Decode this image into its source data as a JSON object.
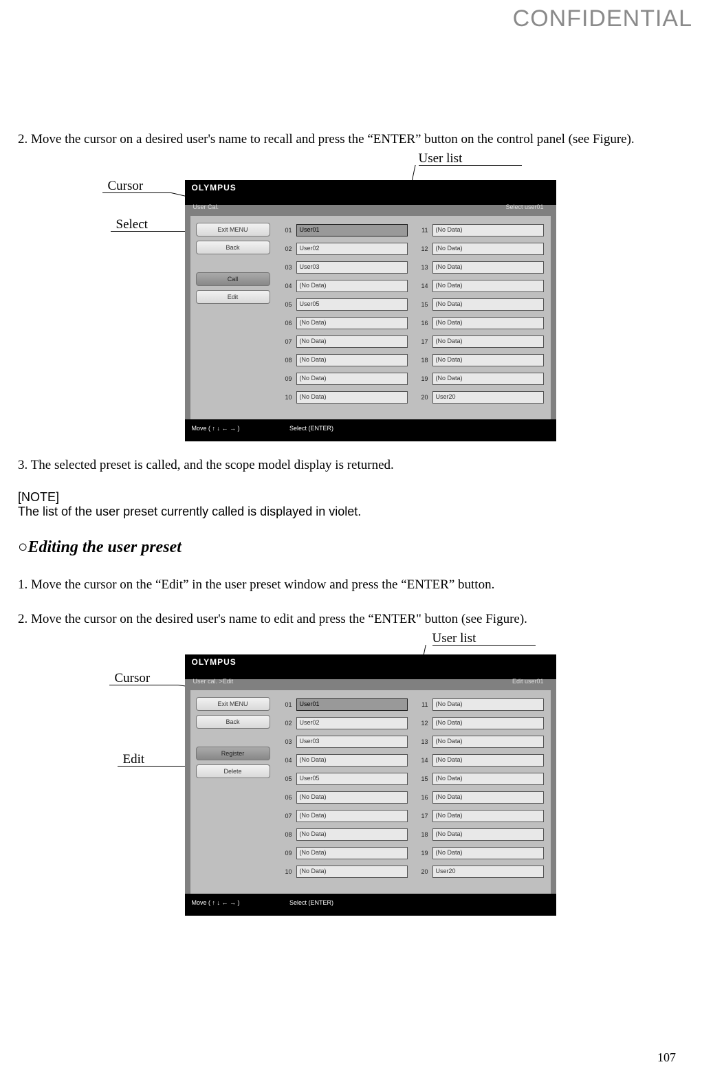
{
  "watermark": "CONFIDENTIAL",
  "page_number": "107",
  "step2": "2. Move the cursor on a desired user's name to recall and press the “ENTER” button on the control panel (see Figure).",
  "step3": "3. The selected preset is called, and the scope model display is returned.",
  "note_label": "[NOTE]",
  "note_body": "The list of the user preset currently called is displayed in violet.",
  "section_heading": "○Editing the user preset",
  "edit_step1": "1. Move the cursor on the “Edit” in the user preset window and press the “ENTER” button.",
  "edit_step2": "2. Move the cursor on the desired user's name to edit and press the “ENTER\" button (see Figure).",
  "callouts": {
    "user_list": "User list",
    "cursor": "Cursor",
    "select": "Select",
    "edit": "Edit"
  },
  "fig1": {
    "brand": "OLYMPUS",
    "subtitle_left": "User Cal.",
    "subtitle_right": "Select user01",
    "footer_left": "Move ( ↑ ↓ ← → )",
    "footer_right": "Select (ENTER)",
    "buttons": [
      "Exit MENU",
      "Back",
      "Call",
      "Edit"
    ],
    "left_col": [
      {
        "n": "01",
        "v": "User01",
        "sel": true
      },
      {
        "n": "02",
        "v": "User02"
      },
      {
        "n": "03",
        "v": "User03"
      },
      {
        "n": "04",
        "v": "(No Data)"
      },
      {
        "n": "05",
        "v": "User05"
      },
      {
        "n": "06",
        "v": "(No Data)"
      },
      {
        "n": "07",
        "v": "(No Data)"
      },
      {
        "n": "08",
        "v": "(No Data)"
      },
      {
        "n": "09",
        "v": "(No Data)"
      },
      {
        "n": "10",
        "v": "(No Data)"
      }
    ],
    "right_col": [
      {
        "n": "11",
        "v": "(No Data)"
      },
      {
        "n": "12",
        "v": "(No Data)"
      },
      {
        "n": "13",
        "v": "(No Data)"
      },
      {
        "n": "14",
        "v": "(No Data)"
      },
      {
        "n": "15",
        "v": "(No Data)"
      },
      {
        "n": "16",
        "v": "(No Data)"
      },
      {
        "n": "17",
        "v": "(No Data)"
      },
      {
        "n": "18",
        "v": "(No Data)"
      },
      {
        "n": "19",
        "v": "(No Data)"
      },
      {
        "n": "20",
        "v": "User20"
      }
    ]
  },
  "fig2": {
    "brand": "OLYMPUS",
    "subtitle_left": "User cal. >Edit",
    "subtitle_right": "Edit user01",
    "footer_left": "Move ( ↑ ↓ ← → )",
    "footer_right": "Select (ENTER)",
    "buttons": [
      "Exit MENU",
      "Back",
      "Register",
      "Delete"
    ],
    "left_col": [
      {
        "n": "01",
        "v": "User01",
        "sel": true
      },
      {
        "n": "02",
        "v": "User02"
      },
      {
        "n": "03",
        "v": "User03"
      },
      {
        "n": "04",
        "v": "(No Data)"
      },
      {
        "n": "05",
        "v": "User05"
      },
      {
        "n": "06",
        "v": "(No Data)"
      },
      {
        "n": "07",
        "v": "(No Data)"
      },
      {
        "n": "08",
        "v": "(No Data)"
      },
      {
        "n": "09",
        "v": "(No Data)"
      },
      {
        "n": "10",
        "v": "(No Data)"
      }
    ],
    "right_col": [
      {
        "n": "11",
        "v": "(No Data)"
      },
      {
        "n": "12",
        "v": "(No Data)"
      },
      {
        "n": "13",
        "v": "(No Data)"
      },
      {
        "n": "14",
        "v": "(No Data)"
      },
      {
        "n": "15",
        "v": "(No Data)"
      },
      {
        "n": "16",
        "v": "(No Data)"
      },
      {
        "n": "17",
        "v": "(No Data)"
      },
      {
        "n": "18",
        "v": "(No Data)"
      },
      {
        "n": "19",
        "v": "(No Data)"
      },
      {
        "n": "20",
        "v": "User20"
      }
    ]
  }
}
